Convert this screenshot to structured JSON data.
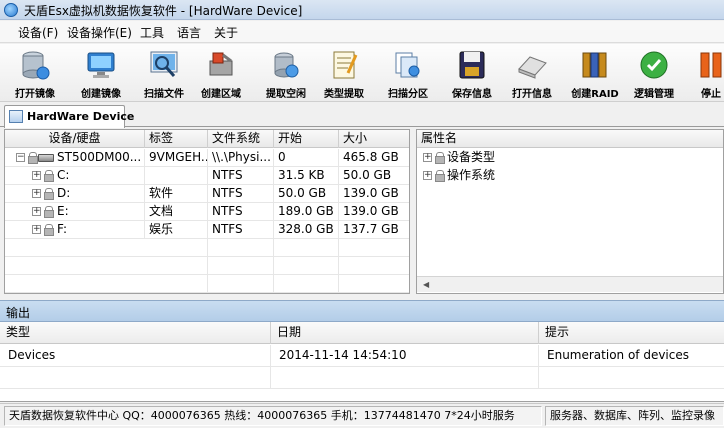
{
  "window": {
    "title": "天盾Esx虚拟机数据恢复软件 - [HardWare Device]"
  },
  "menu": [
    "设备(F)",
    "设备操作(E)",
    "工具",
    "语言",
    "关于"
  ],
  "toolbar": [
    {
      "label": "打开镜像",
      "icon": "open-image-icon"
    },
    {
      "label": "创建镜像",
      "icon": "create-image-icon"
    },
    {
      "label": "扫描文件",
      "icon": "scan-file-icon"
    },
    {
      "label": "创建区域",
      "icon": "create-region-icon"
    },
    {
      "label": "提取空闲",
      "icon": "extract-free-icon"
    },
    {
      "label": "类型提取",
      "icon": "type-extract-icon"
    },
    {
      "label": "扫描分区",
      "icon": "scan-partition-icon"
    },
    {
      "label": "保存信息",
      "icon": "save-info-icon"
    },
    {
      "label": "打开信息",
      "icon": "open-info-icon"
    },
    {
      "label": "创建RAID",
      "icon": "create-raid-icon"
    },
    {
      "label": "逻辑管理",
      "icon": "logic-manage-icon"
    },
    {
      "label": "停止",
      "icon": "stop-icon"
    }
  ],
  "tab": {
    "label": "HardWare Device"
  },
  "device_table": {
    "headers": [
      "设备/硬盘",
      "标签",
      "文件系统",
      "开始",
      "大小"
    ],
    "rows": [
      {
        "name": "ST500DM00...",
        "label": "9VMGEH...",
        "fs": "\\\\.\\Physi...",
        "start": "0",
        "size": "465.8 GB"
      },
      {
        "name": "C:",
        "label": "",
        "fs": "NTFS",
        "start": "31.5 KB",
        "size": "50.0 GB"
      },
      {
        "name": "D:",
        "label": "软件",
        "fs": "NTFS",
        "start": "50.0 GB",
        "size": "139.0 GB"
      },
      {
        "name": "E:",
        "label": "文档",
        "fs": "NTFS",
        "start": "189.0 GB",
        "size": "139.0 GB"
      },
      {
        "name": "F:",
        "label": "娱乐",
        "fs": "NTFS",
        "start": "328.0 GB",
        "size": "137.7 GB"
      }
    ]
  },
  "property_panel": {
    "header": "属性名",
    "items": [
      "设备类型",
      "操作系统"
    ]
  },
  "output": {
    "title": "输出",
    "headers": [
      "类型",
      "日期",
      "提示"
    ],
    "rows": [
      {
        "type": "Devices",
        "date": "2014-11-14 14:54:10",
        "hint": "Enumeration of devices"
      }
    ]
  },
  "status": {
    "left": "天盾数据恢复软件中心 QQ：4000076365 热线：4000076365 手机：13774481470   7*24小时服务",
    "right": "服务器、数据库、阵列、监控录像"
  }
}
